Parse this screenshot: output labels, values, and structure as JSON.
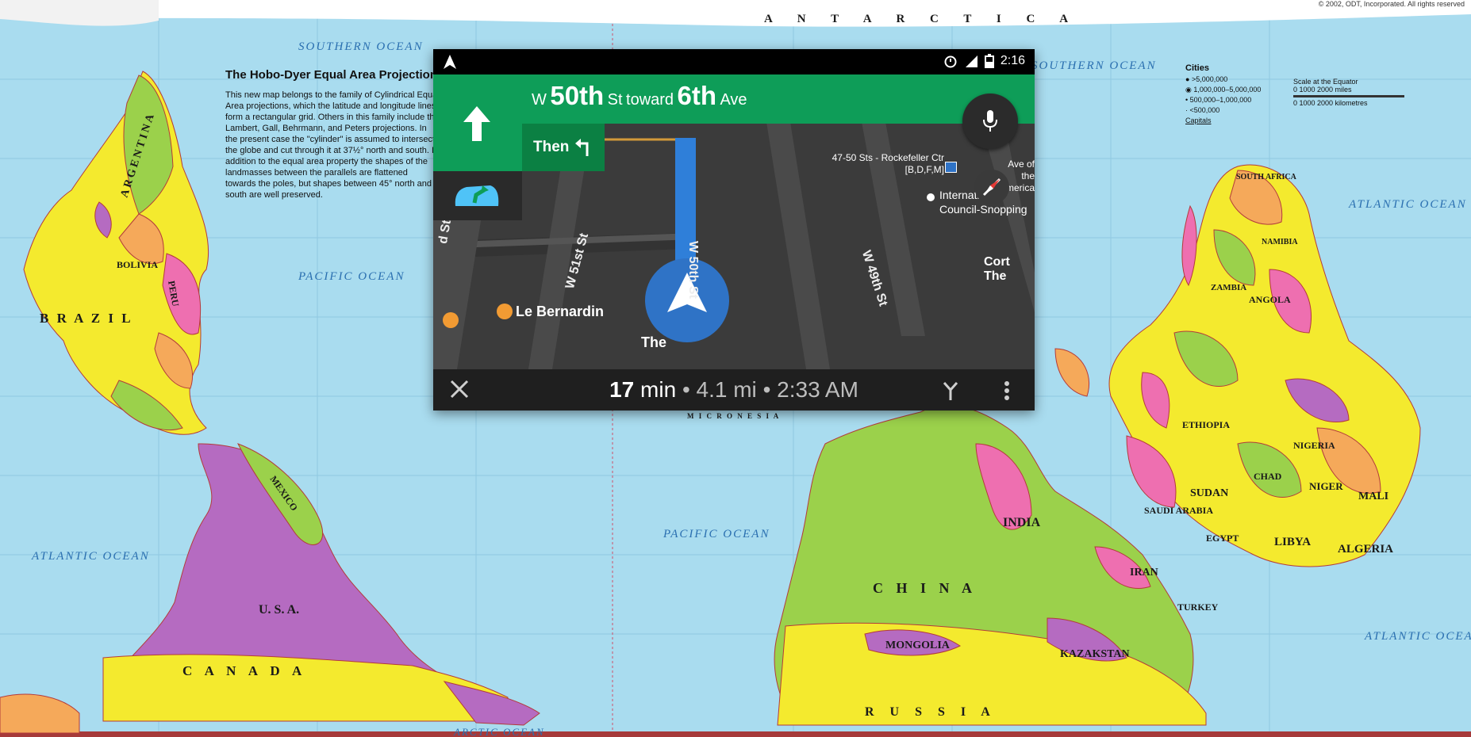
{
  "background_map": {
    "projection_title": "The Hobo-Dyer Equal Area Projection",
    "projection_text": "This new map belongs to the family of Cylindrical Equal Area projections, which the latitude and longitude lines form a rectangular grid. Others in this family include the Lambert, Gall, Behrmann, and Peters projections. In the present case the \"cylinder\" is assumed to intersect the globe and cut through it at 37½° north and south. In addition to the equal area property the shapes of the landmasses between the parallels are flattened towards the poles, but shapes between 45° north and south are well preserved.",
    "copyright": "© 2002, ODT, Incorporated. All rights reserved",
    "antarctica": "A N T A R C T I C A",
    "oceans": {
      "southern_1": "SOUTHERN OCEAN",
      "southern_2": "SOUTHERN OCEAN",
      "pacific_1": "PACIFIC OCEAN",
      "pacific_2": "PACIFIC OCEAN",
      "atlantic_1": "ATLANTIC OCEAN",
      "atlantic_2": "ATLANTIC OCEAN",
      "atlantic_3": "ATLANTIC OCEAN",
      "arctic": "ARCTIC OCEAN"
    },
    "countries": {
      "argentina": "ARGENTINA",
      "brazil": "B R A Z I L",
      "bolivia": "BOLIVIA",
      "peru": "PERU",
      "usa": "U. S. A.",
      "canada": "C A N A D A",
      "mexico": "MEXICO",
      "china": "C H I N A",
      "india": "INDIA",
      "mongolia": "MONGOLIA",
      "kazakstan": "KAZAKSTAN",
      "russia": "R U S S I A",
      "iran": "IRAN",
      "sudan": "SUDAN",
      "libya": "LIBYA",
      "algeria": "ALGERIA",
      "egypt": "EGYPT",
      "saudi_arabia": "SAUDI ARABIA",
      "niger": "NIGER",
      "mali": "MALI",
      "chad": "CHAD",
      "ethiopia": "ETHIOPIA",
      "angola": "ANGOLA",
      "zambia": "ZAMBIA",
      "namibia": "NAMIBIA",
      "south_africa": "SOUTH AFRICA",
      "nigeria": "NIGERIA",
      "turkey": "TURKEY",
      "micronesia": "M I C R O N E S I A"
    },
    "legend": {
      "title": "Cities",
      "items": [
        ">5,000,000",
        "1,000,000–5,000,000",
        "500,000–1,000,000",
        "<500,000",
        "Capitals"
      ],
      "scale_title": "Scale at the Equator",
      "miles": "0        1000        2000 miles",
      "km": "0    1000    2000 kilometres"
    },
    "colors": {
      "ocean": "#a9dcef",
      "yellow": "#f4ea2e",
      "pink": "#ee6fb0",
      "green": "#9bd14b",
      "orange": "#f5a95a",
      "purple": "#b56bc1",
      "border_red": "#b33b3b"
    }
  },
  "navigation": {
    "status_bar": {
      "time": "2:16",
      "icons": [
        "navigation-arrow-icon",
        "alarm-icon",
        "signal-icon",
        "battery-icon"
      ]
    },
    "instruction": {
      "prefix": "W",
      "street_main": "50th",
      "street_suffix": "St",
      "toward": "toward",
      "dest_main": "6th",
      "dest_suffix": "Ave",
      "maneuver_icon": "straight-arrow-icon"
    },
    "then": {
      "label": "Then",
      "icon": "turn-left-icon"
    },
    "map": {
      "streets": [
        "W 51st St",
        "W 50th St",
        "W 49th St",
        "d St"
      ],
      "pois": {
        "rockefeller": "47-50 Sts - Rockefeller Ctr [B,D,F,M]",
        "international": "International Council-Snopping",
        "le_bernardin": "Le Bernardin",
        "the": "The",
        "cort": "Cort The",
        "ave": "Ave of the America"
      }
    },
    "footer": {
      "minutes": "17",
      "min_label": "min",
      "distance": "4.1 mi",
      "arrival": "2:33 AM",
      "separator": "•"
    },
    "colors": {
      "banner": "#0e9d58",
      "banner_dark": "#0b8043",
      "route": "#2f7fd9",
      "road": "#5a5a5a",
      "map_bg": "#3b3b3b"
    }
  }
}
